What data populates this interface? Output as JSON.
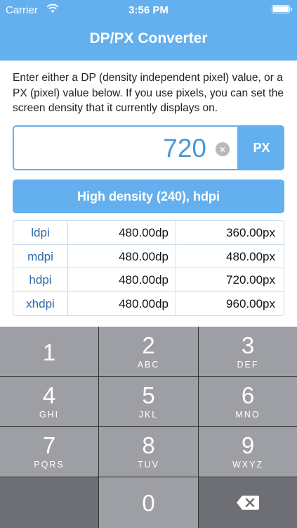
{
  "status_bar": {
    "carrier": "Carrier",
    "time": "3:56 PM",
    "wifi_icon": "wifi-icon",
    "battery_icon": "battery-icon"
  },
  "header": {
    "title": "DP/PX Converter"
  },
  "instructions": "Enter either a DP (density independent pixel) value, or a PX (pixel) value below. If you use pixels, you can set the screen density that it currently displays on.",
  "input": {
    "value": "720",
    "unit_label": "PX",
    "clear_icon": "clear-icon"
  },
  "density_button": {
    "label": "High density (240), hdpi"
  },
  "table": {
    "rows": [
      {
        "name": "ldpi",
        "dp": "480.00dp",
        "px": "360.00px"
      },
      {
        "name": "mdpi",
        "dp": "480.00dp",
        "px": "480.00px"
      },
      {
        "name": "hdpi",
        "dp": "480.00dp",
        "px": "720.00px"
      },
      {
        "name": "xhdpi",
        "dp": "480.00dp",
        "px": "960.00px"
      }
    ]
  },
  "keypad": {
    "keys": [
      {
        "num": "1",
        "letters": ""
      },
      {
        "num": "2",
        "letters": "ABC"
      },
      {
        "num": "3",
        "letters": "DEF"
      },
      {
        "num": "4",
        "letters": "GHI"
      },
      {
        "num": "5",
        "letters": "JKL"
      },
      {
        "num": "6",
        "letters": "MNO"
      },
      {
        "num": "7",
        "letters": "PQRS"
      },
      {
        "num": "8",
        "letters": "TUV"
      },
      {
        "num": "9",
        "letters": "WXYZ"
      },
      {
        "num": "0",
        "letters": ""
      }
    ],
    "delete_icon": "delete-icon"
  },
  "colors": {
    "accent": "#64b0ee",
    "value_text": "#4a98d8",
    "key": "#9e9fa4",
    "key_dark": "#6d6f74"
  }
}
